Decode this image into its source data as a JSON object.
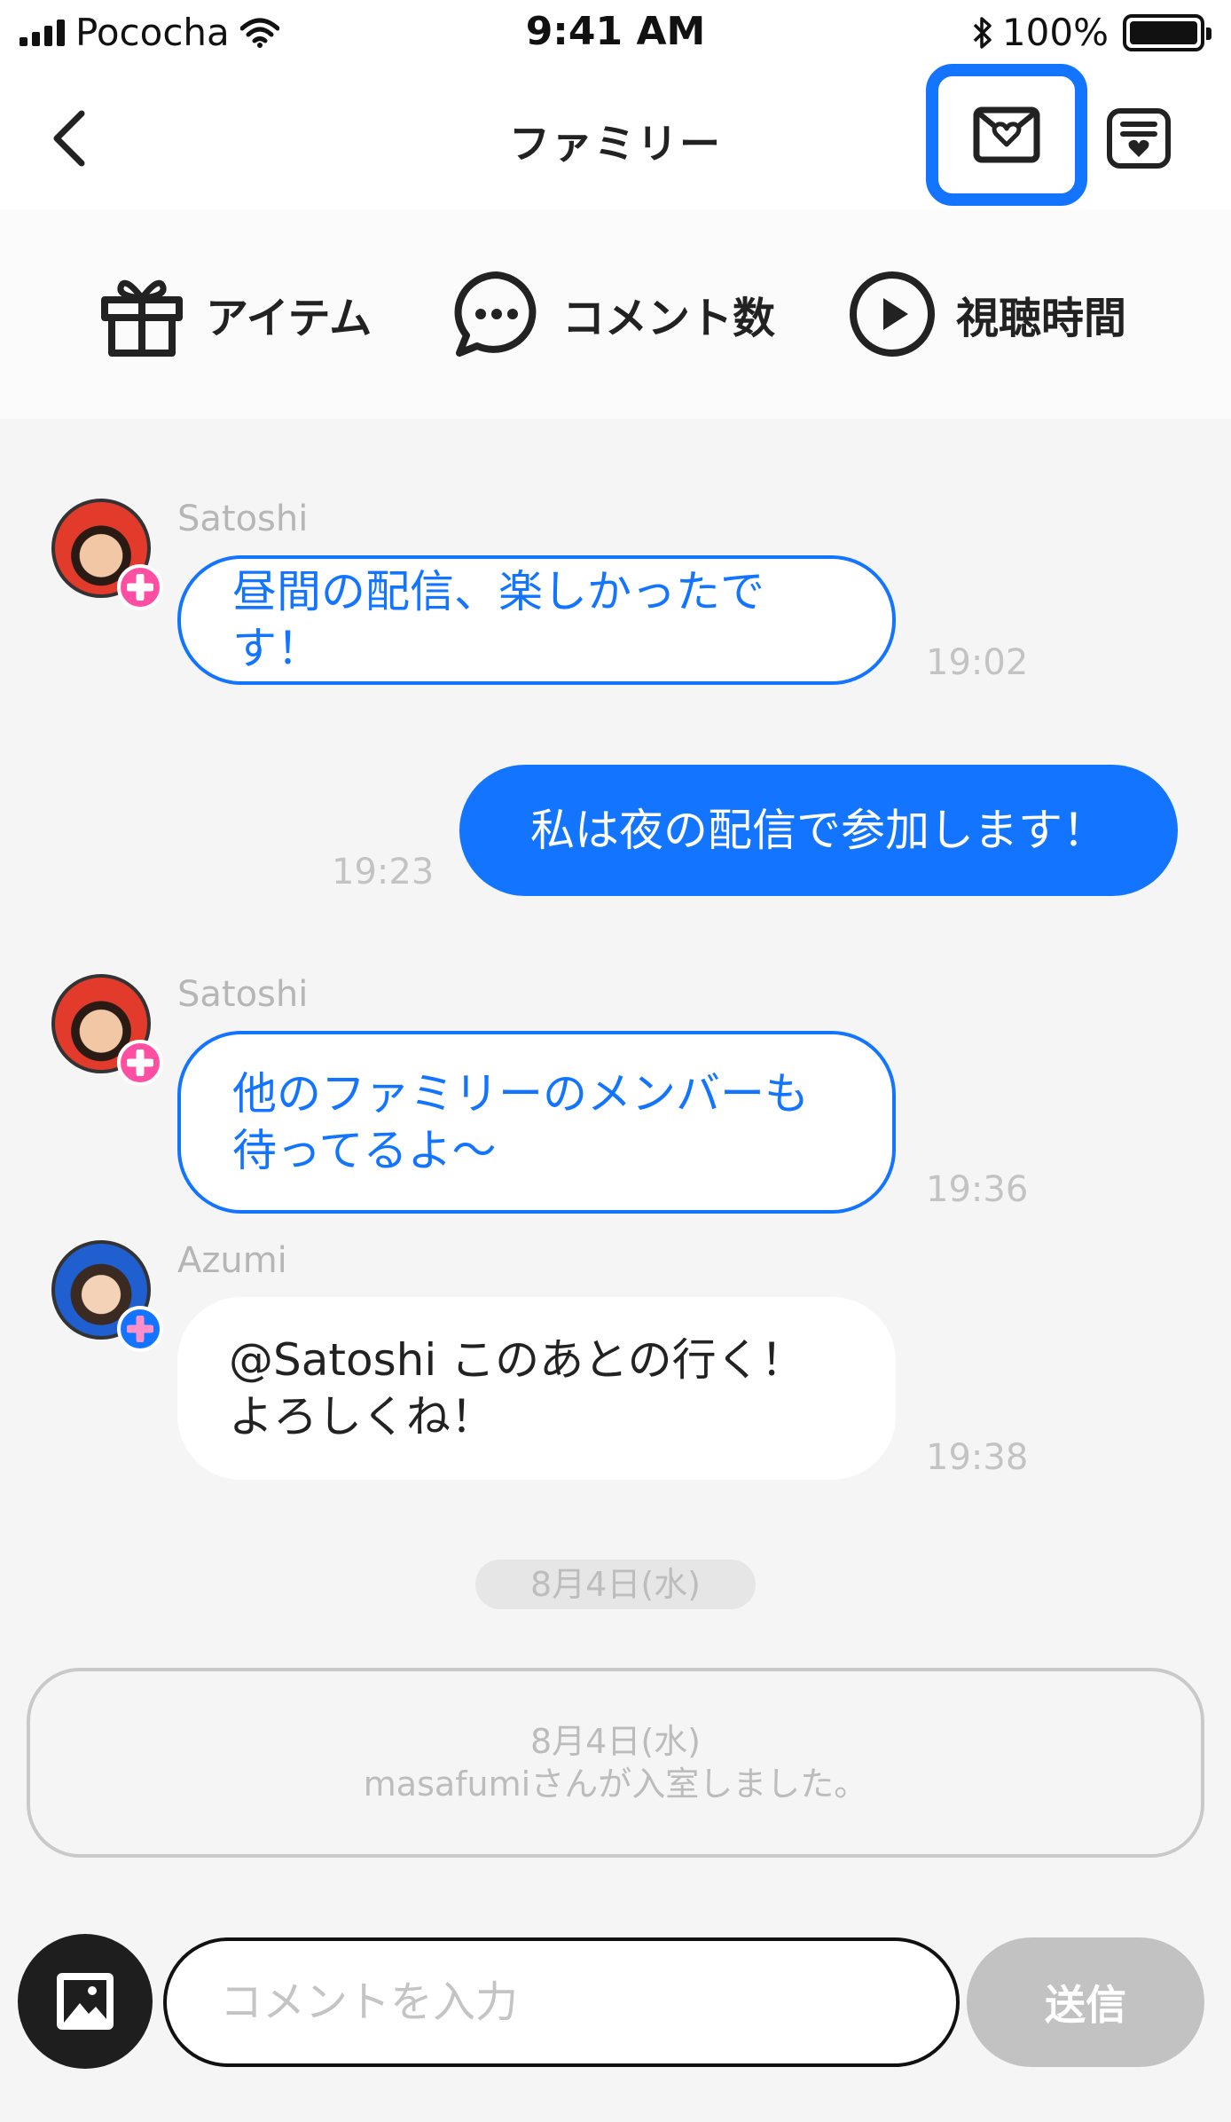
{
  "status_bar": {
    "carrier": "Pococha",
    "time": "9:41 AM",
    "battery": "100%"
  },
  "header": {
    "title": "ファミリー",
    "back_icon": "chevron-left-icon",
    "mail_icon": "mail-heart-icon",
    "list_icon": "heart-list-icon"
  },
  "stats": [
    {
      "label": "アイテム",
      "icon": "gift-icon"
    },
    {
      "label": "コメント数",
      "icon": "chat-bubble-icon"
    },
    {
      "label": "視聴時間",
      "icon": "play-circle-icon"
    }
  ],
  "messages": [
    {
      "sender": "Satoshi",
      "lines": [
        "昼間の配信、楽しかったです！"
      ],
      "time": "19:02"
    },
    {
      "sender": "",
      "lines": [
        "私は夜の配信で参加します！"
      ],
      "time": "19:23"
    },
    {
      "sender": "Satoshi",
      "lines": [
        "他のファミリーのメンバーも",
        "待ってるよ〜"
      ],
      "time": "19:36"
    },
    {
      "sender": "Azumi",
      "lines": [
        "@Satoshi このあとの行く！",
        "よろしくね！"
      ],
      "time": "19:38"
    }
  ],
  "date_divider": "8月4日(水)",
  "system_notice": {
    "date": "8月4日(水)",
    "text": "masafumiさんが入室しました。"
  },
  "composer": {
    "placeholder": "コメントを入力",
    "send_label": "送信",
    "image_icon": "image-icon"
  },
  "colors": {
    "accent": "#1274ff",
    "badge_pink": "#ff4fa3",
    "send_disabled": "#c2c2c2"
  }
}
